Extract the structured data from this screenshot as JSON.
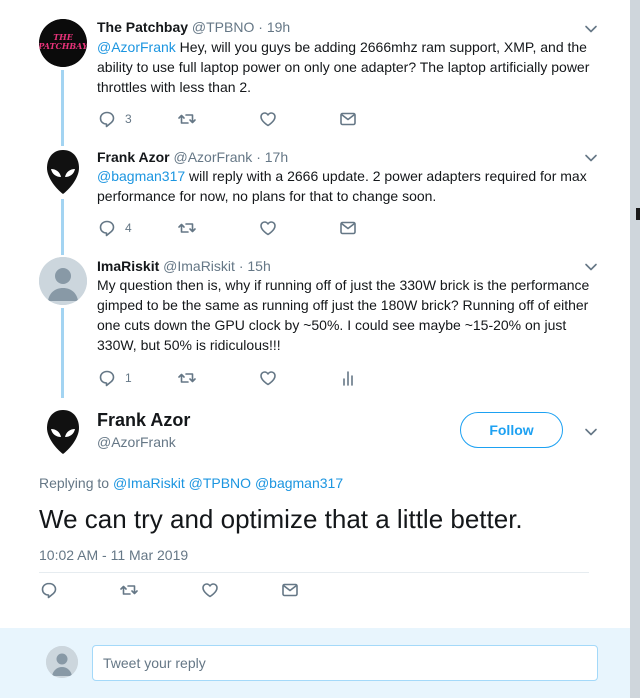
{
  "colors": {
    "accent": "#1da1f2",
    "link": "#1b95e0",
    "muted": "#657786",
    "thread": "#a3d4f2",
    "reply_bg": "#e8f5fd"
  },
  "tweets": [
    {
      "name": "The Patchbay",
      "handle": "@TPBNO",
      "dot": "·",
      "time": "19h",
      "avatar_text": "THE PATCHBAY",
      "mention": "@AzorFrank",
      "text_line1_rest": " Hey, will you guys be adding 2666mhz ram support, XMP, and the",
      "text_line2": "ability to use full laptop power on only one adapter? The laptop artificially power",
      "text_line3": "throttles with less than 2.",
      "reply_count": "3",
      "icons": [
        "reply-icon",
        "retweet-icon",
        "like-icon",
        "message-icon"
      ]
    },
    {
      "name": "Frank Azor",
      "handle": "@AzorFrank",
      "dot": "·",
      "time": "17h",
      "mention": "@bagman317",
      "text_line1_rest": " will reply with a 2666 update.  2 power adapters required for max",
      "text_line2": "performance for now, no plans for that to change soon.",
      "reply_count": "4",
      "icons": [
        "reply-icon",
        "retweet-icon",
        "like-icon",
        "message-icon"
      ]
    },
    {
      "name": "ImaRiskit",
      "handle": "@ImaRiskit",
      "dot": "·",
      "time": "15h",
      "text_line1": "My question then is, why if running off of just the 330W brick is the performance",
      "text_line2": "gimped to be the same as running off just the 180W brick? Running off of either",
      "text_line3": "one cuts down the GPU clock by ~50%. I could see maybe ~15-20% on just",
      "text_line4": "330W, but 50% is ridiculous!!!",
      "reply_count": "1",
      "icons": [
        "reply-icon",
        "retweet-icon",
        "like-icon",
        "analytics-icon"
      ]
    }
  ],
  "main": {
    "name": "Frank Azor",
    "handle": "@AzorFrank",
    "follow_label": "Follow",
    "replying_prefix": "Replying to",
    "replying_to": [
      "@ImaRiskit",
      "@TPBNO",
      "@bagman317"
    ],
    "text": "We can try and optimize that a little better.",
    "timestamp": "10:02 AM - 11 Mar 2019",
    "icons": [
      "reply-icon",
      "retweet-icon",
      "like-icon",
      "message-icon"
    ]
  },
  "reply_box": {
    "placeholder": "Tweet your reply"
  }
}
